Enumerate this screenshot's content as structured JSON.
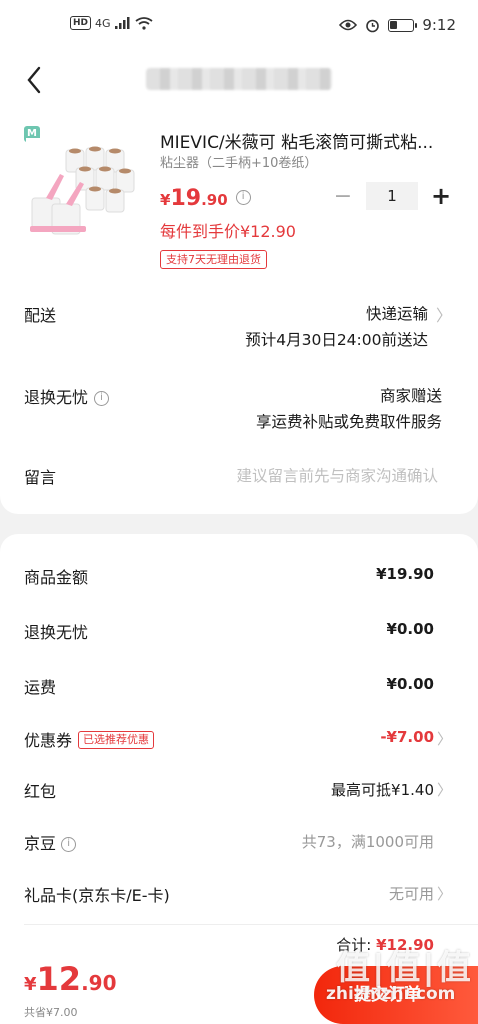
{
  "status_bar": {
    "network": "4G",
    "time": "9:12"
  },
  "header": {
    "back_icon": "chevron-left-icon"
  },
  "product": {
    "title": "MIEVIC/米薇可 粘毛滚筒可撕式粘...",
    "spec": "粘尘器（二手柄+10卷纸）",
    "price_symbol": "¥",
    "price_int": "19",
    "price_dec": ".90",
    "quantity": "1",
    "each_price": "每件到手价¥12.90",
    "badge": "支持7天无理由退货",
    "minus_label": "−",
    "plus_label": "+"
  },
  "delivery": {
    "label": "配送",
    "method": "快递运输",
    "eta": "预计4月30日24:00前送达"
  },
  "return": {
    "label": "退换无忧",
    "value": "商家赠送",
    "desc": "享运费补贴或免费取件服务"
  },
  "message": {
    "label": "留言",
    "placeholder": "建议留言前先与商家沟通确认"
  },
  "costs": {
    "goods_label": "商品金额",
    "goods_value": "¥19.90",
    "return_label": "退换无忧",
    "return_value": "¥0.00",
    "shipping_label": "运费",
    "shipping_value": "¥0.00",
    "coupon_label": "优惠券",
    "coupon_tag": "已选推荐优惠",
    "coupon_value": "-¥7.00",
    "redpacket_label": "红包",
    "redpacket_value": "最高可抵¥1.40",
    "jingdou_label": "京豆",
    "jingdou_value": "共73，满1000可用",
    "giftcard_label": "礼品卡(京东卡/E-卡)",
    "giftcard_value": "无可用"
  },
  "footer": {
    "total_label": "合计:",
    "total_value": "¥12.90",
    "final_symbol": "¥",
    "final_int": "12",
    "final_dec": ".90",
    "saved": "共省¥7.00",
    "submit": "提交订单",
    "watermark_logo": "值|值|值",
    "watermark_text": "zhizhizhi.com"
  },
  "colors": {
    "accent_red": "#e4393c",
    "button_red": "#f2270c"
  }
}
